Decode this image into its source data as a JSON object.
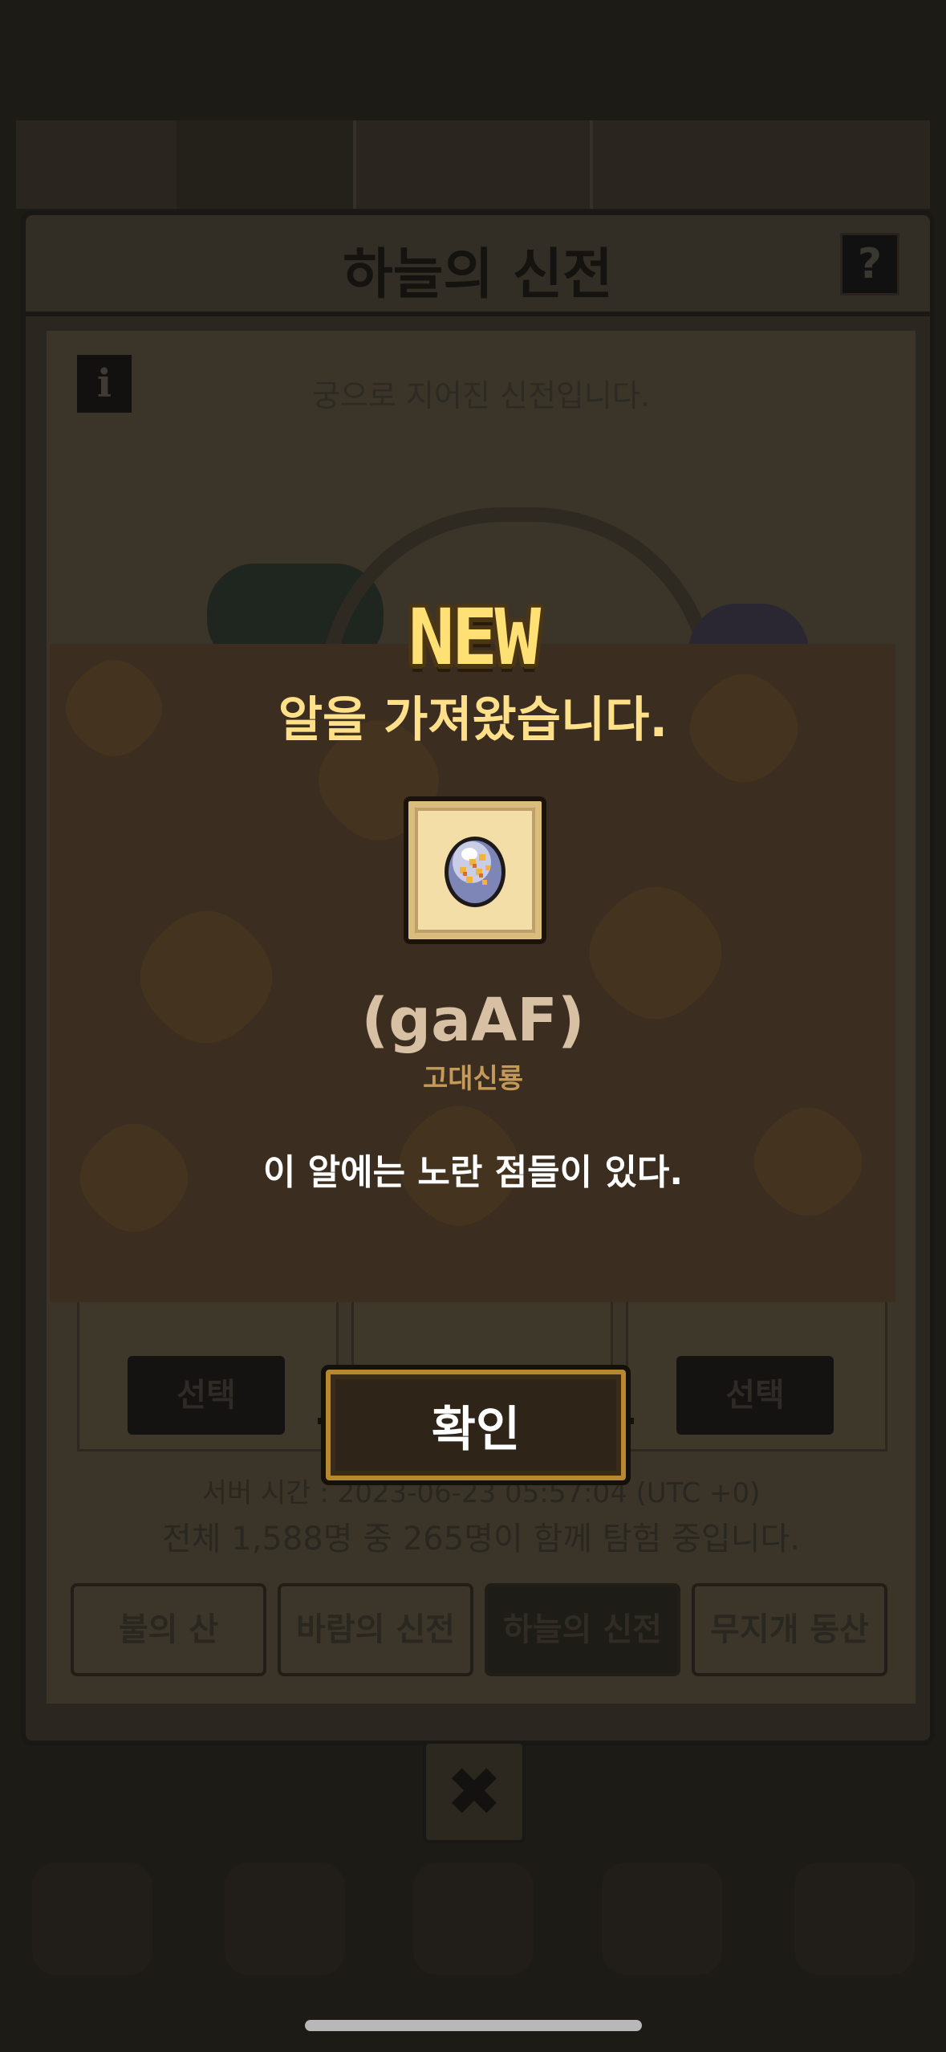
{
  "modal": {
    "badge": "NEW",
    "title": "알을 가져왔습니다.",
    "item": {
      "name": "(gaAF)",
      "type": "고대신룡",
      "description": "이 알에는 노란 점들이 있다.",
      "icon": "egg-icon"
    },
    "confirm_label": "확인"
  },
  "background": {
    "panel_title": "하늘의 신전",
    "help_label": "?",
    "info_label": "i",
    "description": "궁으로 지어진 신전입니다.",
    "select_labels": [
      "선택",
      "선택"
    ],
    "server_time": "서버 시간 : 2023-06-23 05:57:04 (UTC +0)",
    "player_count": "전체 1,588명 중 265명이 함께 탐험 중입니다.",
    "tabs": [
      {
        "label": "불의 산",
        "active": false
      },
      {
        "label": "바람의 신전",
        "active": false
      },
      {
        "label": "하늘의 신전",
        "active": true
      },
      {
        "label": "무지개 동산",
        "active": false
      }
    ],
    "close_icon": "close-icon"
  },
  "colors": {
    "accent_gold": "#ffe08a",
    "modal_bg": "#3b2d1f",
    "item_name": "#d7c0a3",
    "item_type": "#c49a58"
  }
}
